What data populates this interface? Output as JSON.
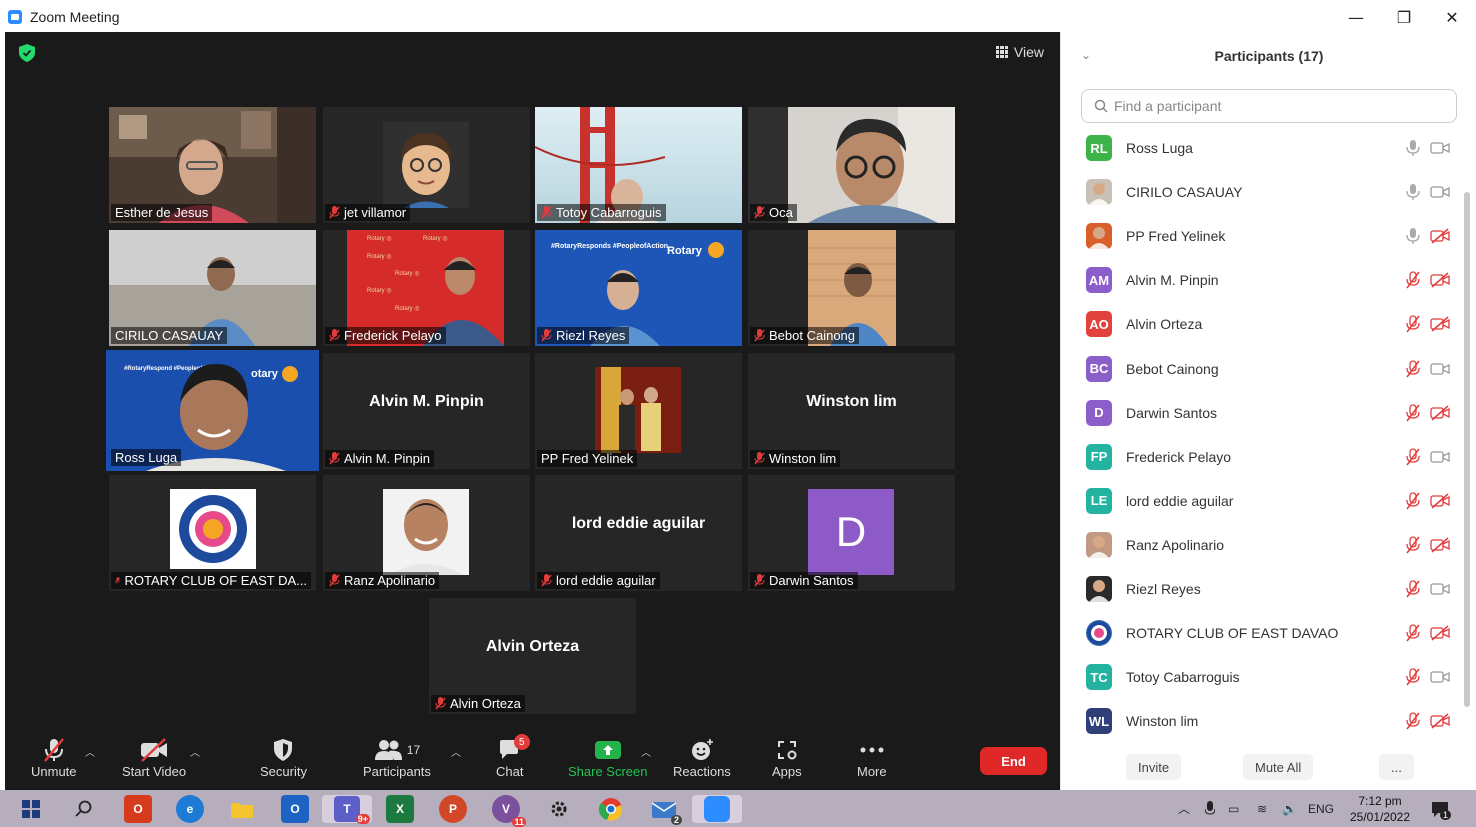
{
  "window": {
    "title": "Zoom Meeting",
    "minimize_glyph": "—",
    "restore_glyph": "❐",
    "close_glyph": "✕"
  },
  "video": {
    "view_label": "View",
    "tiles": [
      {
        "label": "Esther de Jesus",
        "muted": false,
        "type": "video"
      },
      {
        "label": "jet villamor",
        "muted": true,
        "type": "memoji"
      },
      {
        "label": "Totoy Cabarroguis",
        "muted": true,
        "type": "video"
      },
      {
        "label": "Oca",
        "muted": true,
        "type": "video"
      },
      {
        "label": "CIRILO CASAUAY",
        "muted": false,
        "type": "video"
      },
      {
        "label": "Frederick Pelayo",
        "muted": true,
        "type": "video"
      },
      {
        "label": "Riezl Reyes",
        "muted": true,
        "type": "video"
      },
      {
        "label": "Bebot Cainong",
        "muted": true,
        "type": "video"
      },
      {
        "label": "Ross Luga",
        "muted": false,
        "type": "video",
        "active": true
      },
      {
        "label": "Alvin M. Pinpin",
        "muted": true,
        "type": "name",
        "center": "Alvin M. Pinpin"
      },
      {
        "label": "PP Fred Yelinek",
        "muted": false,
        "type": "photo"
      },
      {
        "label": "Winston lim",
        "muted": true,
        "type": "name",
        "center": "Winston lim"
      },
      {
        "label": "ROTARY CLUB OF EAST DA...",
        "muted": true,
        "type": "logo"
      },
      {
        "label": "Ranz Apolinario",
        "muted": true,
        "type": "photo"
      },
      {
        "label": "lord eddie aguilar",
        "muted": true,
        "type": "name",
        "center": "lord eddie aguilar"
      },
      {
        "label": "Darwin Santos",
        "muted": true,
        "type": "letter",
        "letter": "D"
      },
      {
        "label": "Alvin Orteza",
        "muted": true,
        "type": "name",
        "center": "Alvin Orteza"
      }
    ],
    "rotary_text": "Rotary",
    "rotary_hashtags": "#RotaryResponds #PeopleofAction",
    "rotary_partial": "otary",
    "rotary_hashtags_partial": "#RotaryRespond #PeopleofActio"
  },
  "toolbar": {
    "unmute": "Unmute",
    "start_video": "Start Video",
    "security": "Security",
    "participants": "Participants",
    "participants_count": "17",
    "chat": "Chat",
    "chat_badge": "5",
    "share_screen": "Share Screen",
    "reactions": "Reactions",
    "apps": "Apps",
    "more": "More",
    "end": "End"
  },
  "panel": {
    "title": "Participants (17)",
    "search_placeholder": "Find a participant",
    "invite": "Invite",
    "mute_all": "Mute All",
    "more": "...",
    "participants": [
      {
        "initials": "RL",
        "name": "Ross Luga",
        "color": "#3db34a",
        "mic": "on",
        "cam": "on"
      },
      {
        "initials": "",
        "name": "CIRILO CASAUAY",
        "color": "#c9c0b6",
        "mic": "on",
        "cam": "on",
        "avatar": "photo"
      },
      {
        "initials": "",
        "name": "PP Fred Yelinek",
        "color": "#d9602a",
        "mic": "on",
        "cam": "off",
        "avatar": "photo"
      },
      {
        "initials": "AM",
        "name": "Alvin M. Pinpin",
        "color": "#8b5ec9",
        "mic": "off",
        "cam": "off"
      },
      {
        "initials": "AO",
        "name": "Alvin Orteza",
        "color": "#e3413c",
        "mic": "off",
        "cam": "off"
      },
      {
        "initials": "BC",
        "name": "Bebot Cainong",
        "color": "#8b5ec9",
        "mic": "off",
        "cam": "on"
      },
      {
        "initials": "D",
        "name": "Darwin Santos",
        "color": "#8b5ec9",
        "mic": "off",
        "cam": "off"
      },
      {
        "initials": "FP",
        "name": "Frederick Pelayo",
        "color": "#23b3a0",
        "mic": "off",
        "cam": "on"
      },
      {
        "initials": "LE",
        "name": "lord eddie aguilar",
        "color": "#23b3a0",
        "mic": "off",
        "cam": "off"
      },
      {
        "initials": "",
        "name": "Ranz Apolinario",
        "color": "#c29a84",
        "mic": "off",
        "cam": "off",
        "avatar": "photo"
      },
      {
        "initials": "",
        "name": "Riezl Reyes",
        "color": "#2a2a2a",
        "mic": "off",
        "cam": "on",
        "avatar": "photo"
      },
      {
        "initials": "",
        "name": "ROTARY CLUB OF EAST DAVAO",
        "color": "#3e6fb3",
        "mic": "off",
        "cam": "off",
        "avatar": "logo"
      },
      {
        "initials": "TC",
        "name": "Totoy Cabarroguis",
        "color": "#23b3a0",
        "mic": "off",
        "cam": "on"
      },
      {
        "initials": "WL",
        "name": "Winston lim",
        "color": "#2f3f78",
        "mic": "off",
        "cam": "off"
      }
    ]
  },
  "taskbar": {
    "teams_badge": "9+",
    "viber_badge": "11",
    "mail_badge": "2",
    "language": "ENG",
    "time": "7:12 pm",
    "date": "25/01/2022",
    "notification_badge": "1"
  }
}
